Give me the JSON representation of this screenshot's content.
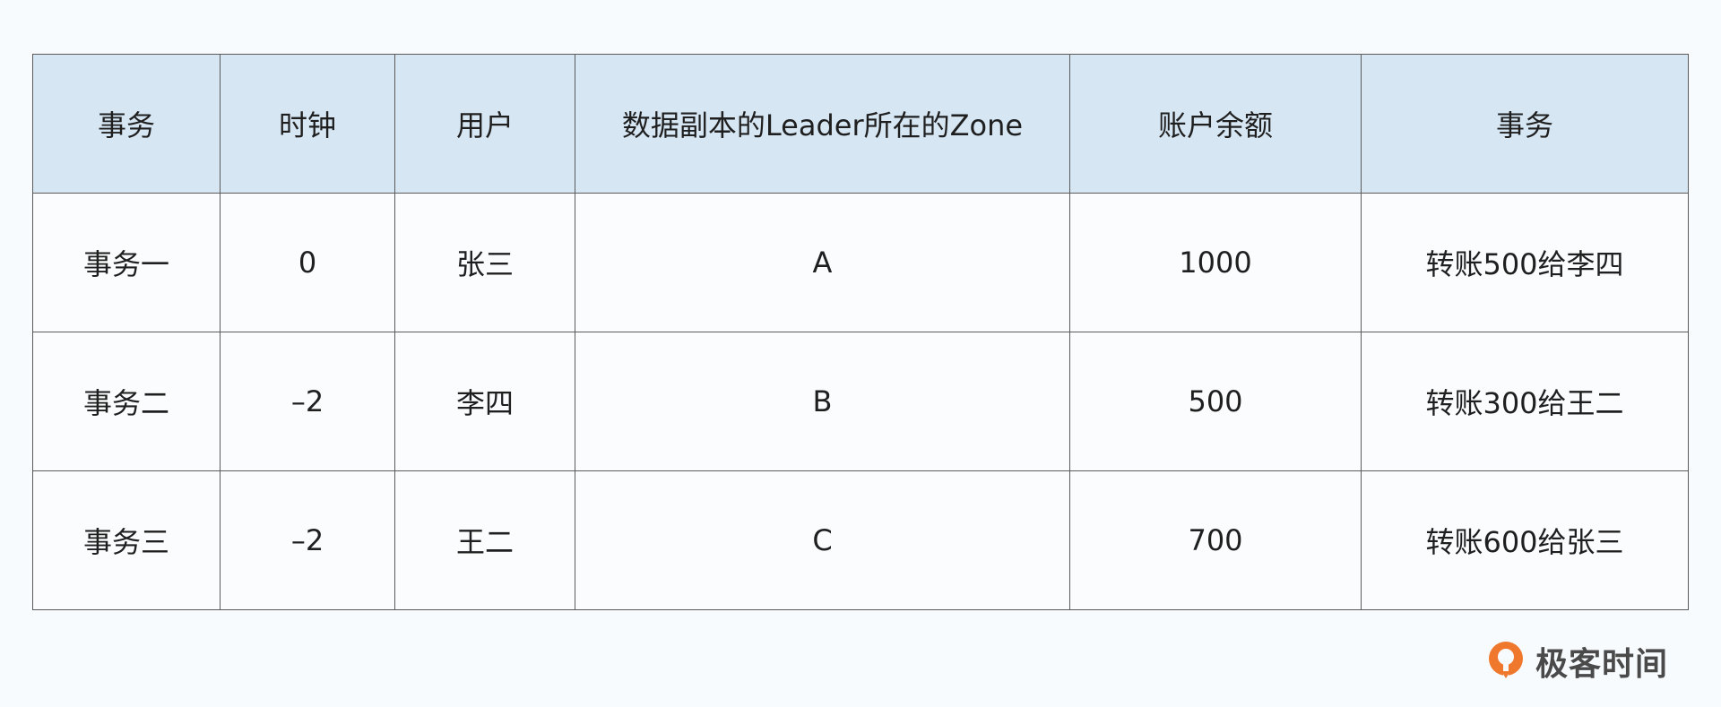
{
  "table": {
    "headers": [
      "事务",
      "时钟",
      "用户",
      "数据副本的Leader所在的Zone",
      "账户余额",
      "事务"
    ],
    "rows": [
      [
        "事务一",
        "0",
        "张三",
        "A",
        "1000",
        "转账500给李四"
      ],
      [
        "事务二",
        "–2",
        "李四",
        "B",
        "500",
        "转账300给王二"
      ],
      [
        "事务三",
        "–2",
        "王二",
        "C",
        "700",
        "转账600给张三"
      ]
    ]
  },
  "brand": {
    "logo_text": "极客时间",
    "logo_icon": "geektime-logo-icon",
    "accent_color": "#f0782d"
  }
}
